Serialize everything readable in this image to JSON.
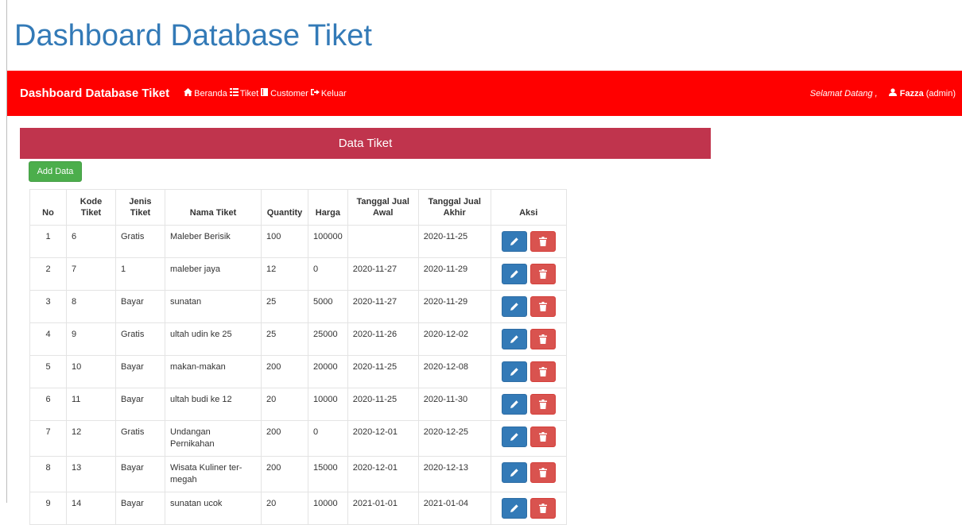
{
  "page": {
    "title": "Dashboard Database Tiket"
  },
  "navbar": {
    "brand": "Dashboard Database Tiket",
    "links": [
      {
        "label": "Beranda",
        "icon": "home-icon"
      },
      {
        "label": "Tiket",
        "icon": "list-icon"
      },
      {
        "label": "Customer",
        "icon": "book-icon"
      },
      {
        "label": "Keluar",
        "icon": "logout-icon"
      }
    ],
    "welcome": "Selamat Datang ,",
    "user_name": "Fazza",
    "user_role": "(admin)",
    "bg_color": "#ff0000"
  },
  "panel": {
    "heading": "Data Tiket",
    "add_label": "Add Data"
  },
  "table": {
    "headers": {
      "no": "No",
      "kode": [
        "Kode",
        "Tiket"
      ],
      "jenis": [
        "Jenis",
        "Tiket"
      ],
      "nama": "Nama Tiket",
      "qty": "Quantity",
      "harga": "Harga",
      "awal": [
        "Tanggal Jual",
        "Awal"
      ],
      "akhir": [
        "Tanggal Jual",
        "Akhir"
      ],
      "aksi": "Aksi"
    },
    "rows": [
      {
        "no": "1",
        "kode": "6",
        "jenis": "Gratis",
        "nama": "Maleber Berisik",
        "qty": "100",
        "harga": "100000",
        "awal": "",
        "akhir": "2020-11-25"
      },
      {
        "no": "2",
        "kode": "7",
        "jenis": "1",
        "nama": "maleber jaya",
        "qty": "12",
        "harga": "0",
        "awal": "2020-11-27",
        "akhir": "2020-11-29"
      },
      {
        "no": "3",
        "kode": "8",
        "jenis": "Bayar",
        "nama": "sunatan",
        "qty": "25",
        "harga": "5000",
        "awal": "2020-11-27",
        "akhir": "2020-11-29"
      },
      {
        "no": "4",
        "kode": "9",
        "jenis": "Gratis",
        "nama": "ultah udin ke 25",
        "qty": "25",
        "harga": "25000",
        "awal": "2020-11-26",
        "akhir": "2020-12-02"
      },
      {
        "no": "5",
        "kode": "10",
        "jenis": "Bayar",
        "nama": "makan-makan",
        "qty": "200",
        "harga": "20000",
        "awal": "2020-11-25",
        "akhir": "2020-12-08"
      },
      {
        "no": "6",
        "kode": "11",
        "jenis": "Bayar",
        "nama": "ultah budi ke 12",
        "qty": "20",
        "harga": "10000",
        "awal": "2020-11-25",
        "akhir": "2020-11-30"
      },
      {
        "no": "7",
        "kode": "12",
        "jenis": "Gratis",
        "nama": "Undangan Pernikahan",
        "qty": "200",
        "harga": "0",
        "awal": "2020-12-01",
        "akhir": "2020-12-25"
      },
      {
        "no": "8",
        "kode": "13",
        "jenis": "Bayar",
        "nama": "Wisata Kuliner ter-megah",
        "qty": "200",
        "harga": "15000",
        "awal": "2020-12-01",
        "akhir": "2020-12-13"
      },
      {
        "no": "9",
        "kode": "14",
        "jenis": "Bayar",
        "nama": "sunatan ucok",
        "qty": "20",
        "harga": "10000",
        "awal": "2021-01-01",
        "akhir": "2021-01-04"
      }
    ]
  }
}
